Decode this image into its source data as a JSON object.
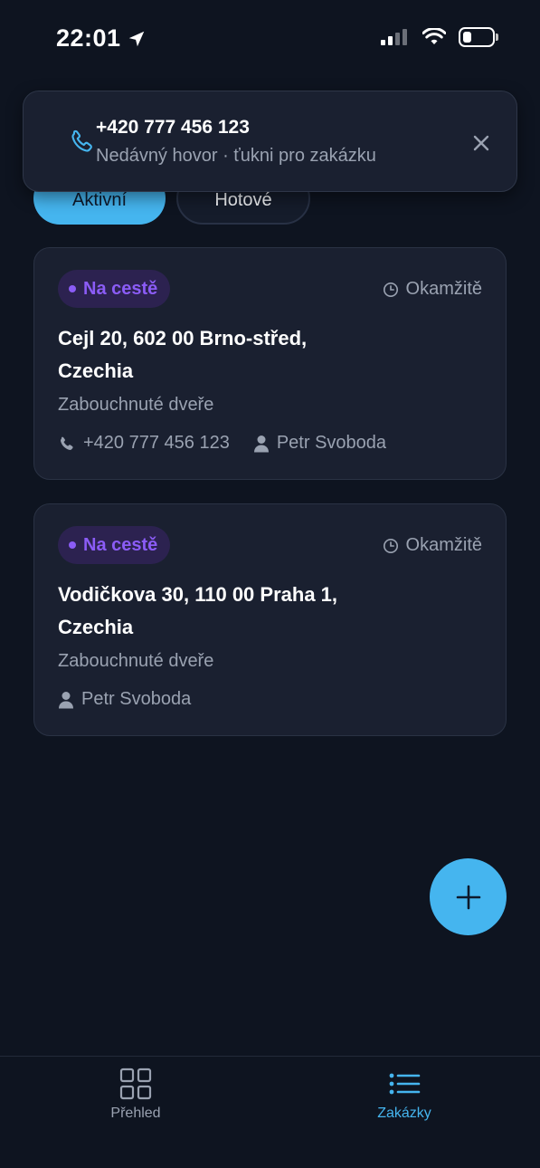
{
  "status_bar": {
    "time": "22:01",
    "icons": [
      "location-arrow-icon",
      "cellular-signal-icon",
      "wifi-icon",
      "battery-icon"
    ]
  },
  "colors": {
    "background": "#0e1420",
    "card": "#1a2030",
    "accent": "#45b5ef",
    "status_purple": "#8b5cf6",
    "muted_text": "#9aa2b1"
  },
  "notification": {
    "title": "+420 777 456 123",
    "subtitle": "Nedávný hovor · ťukni pro zakázku",
    "icon": "phone-icon",
    "close_icon": "close-icon"
  },
  "filters": {
    "active_label": "Aktivní",
    "done_label": "Hotové",
    "selected": "Aktivní"
  },
  "jobs": [
    {
      "status": "Na cestě",
      "timing": "Okamžitě",
      "address_line1": "Cejl 20, 602 00 Brno-střed,",
      "address_line2": "Czechia",
      "service": "Zabouchnuté dveře",
      "phone": "+420 777 456 123",
      "assignee": "Petr Svoboda"
    },
    {
      "status": "Na cestě",
      "timing": "Okamžitě",
      "address_line1": "Vodičkova 30, 110 00 Praha 1,",
      "address_line2": "Czechia",
      "service": "Zabouchnuté dveře",
      "assignee": "Petr Svoboda"
    }
  ],
  "fab": {
    "icon": "plus-icon"
  },
  "tab_bar": {
    "overview_label": "Přehled",
    "orders_label": "Zakázky",
    "selected": "Zakázky"
  }
}
